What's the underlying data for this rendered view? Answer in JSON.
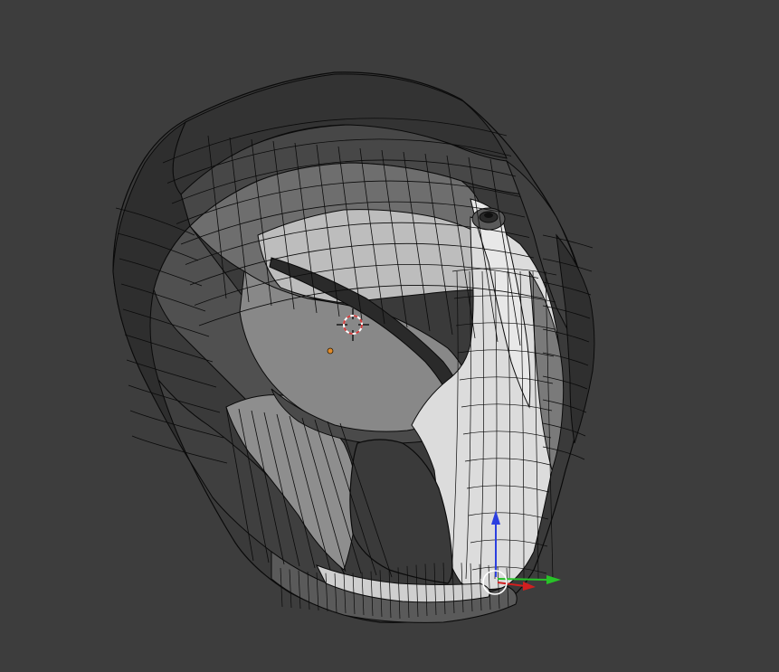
{
  "viewport": {
    "background_color": "#3d3d3d",
    "mesh_object": "helmet-mesh",
    "shading": "solid",
    "overlay": "wireframe"
  },
  "colors": {
    "mesh_dark": "#3b3b3b",
    "mesh_mid": "#6a6a6a",
    "mesh_light": "#d9d9d9",
    "wire": "#0a0a0a",
    "cursor_red": "#d23b3b",
    "origin_orange": "#e08a2a",
    "axis_x": "#d11f1f",
    "axis_y": "#28c228",
    "axis_z": "#2b3fe0"
  },
  "icons": {
    "cursor": "3d-cursor-icon",
    "origin": "object-origin-icon",
    "gizmo": "transform-gizmo-icon"
  }
}
